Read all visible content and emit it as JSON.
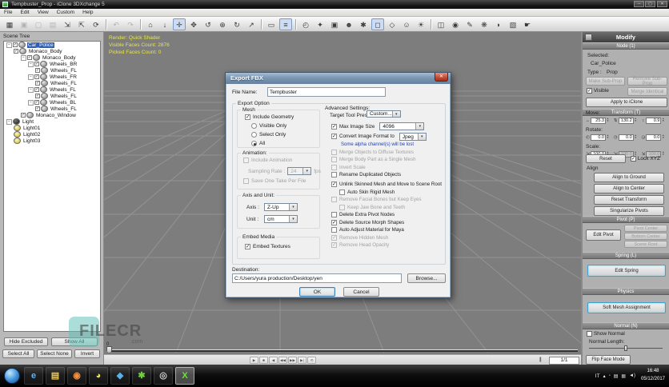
{
  "colors": {
    "selection": "#2f5fb3",
    "hud_text": "#e8e34f",
    "note_blue": "#1a3fc4",
    "watermark_teal": "#66c2b8",
    "accent_button": "#3f9fd0"
  },
  "window": {
    "title": "Tempbuster_Prop - iClone 3DXchange 5",
    "menus": [
      "File",
      "Edit",
      "View",
      "Custom",
      "Help"
    ],
    "controls": {
      "minimize": "─",
      "maximize": "▢",
      "close": "✕"
    }
  },
  "toolbar": {
    "icons": [
      {
        "glyph": "▦",
        "name": "scene-tree-toggle-icon"
      },
      {
        "glyph": "▣",
        "name": "copy-icon",
        "state": "disabled"
      },
      {
        "glyph": "▢",
        "name": "paste-icon",
        "state": "disabled"
      },
      {
        "glyph": "▤",
        "name": "duplicate-icon",
        "state": "disabled"
      },
      {
        "glyph": "⇲",
        "name": "import-icon"
      },
      {
        "glyph": "⇱",
        "name": "export-icon"
      },
      {
        "glyph": "⟳",
        "name": "refresh-icon"
      },
      {
        "sep": true
      },
      {
        "glyph": "↶",
        "name": "undo-icon",
        "state": "disabled"
      },
      {
        "glyph": "↷",
        "name": "redo-icon",
        "state": "disabled"
      },
      {
        "sep": true
      },
      {
        "glyph": "⌂",
        "name": "camera-home-icon"
      },
      {
        "glyph": "↓",
        "name": "camera-top-icon"
      },
      {
        "glyph": "✛",
        "name": "move-tool-icon",
        "state": "pressed"
      },
      {
        "glyph": "✥",
        "name": "pan-tool-icon"
      },
      {
        "glyph": "↺",
        "name": "orbit-tool-icon"
      },
      {
        "glyph": "⊕",
        "name": "zoom-tool-icon"
      },
      {
        "glyph": "↻",
        "name": "rotate-tool-icon"
      },
      {
        "glyph": "↗",
        "name": "frame-all-icon"
      },
      {
        "sep": true
      },
      {
        "glyph": "▭",
        "name": "render-mode-icon"
      },
      {
        "glyph": "≡",
        "name": "scene-list-icon",
        "state": "pressed"
      },
      {
        "sep": true
      },
      {
        "glyph": "◴",
        "name": "turntable-icon"
      },
      {
        "glyph": "✦",
        "name": "pin-icon"
      },
      {
        "glyph": "▣",
        "name": "display-icon"
      },
      {
        "glyph": "☻",
        "name": "avatar-icon"
      },
      {
        "glyph": "✱",
        "name": "settings-icon"
      },
      {
        "glyph": "◻",
        "name": "marquee-select-icon",
        "state": "pressed"
      },
      {
        "glyph": "◇",
        "name": "lock-icon"
      },
      {
        "glyph": "☺",
        "name": "actor-icon"
      },
      {
        "glyph": "☀",
        "name": "light-icon"
      },
      {
        "sep": true
      },
      {
        "glyph": "◫",
        "name": "stage-icon"
      },
      {
        "glyph": "◉",
        "name": "material-icon"
      },
      {
        "glyph": "✎",
        "name": "edit-pose-icon"
      },
      {
        "glyph": "❋",
        "name": "spring-icon"
      },
      {
        "glyph": "◗",
        "name": "head-icon"
      },
      {
        "glyph": "▧",
        "name": "props-icon"
      },
      {
        "glyph": "☛",
        "name": "hand-icon"
      }
    ]
  },
  "scene_tree": {
    "title": "Scene Tree",
    "items": [
      {
        "label": "Car_Police",
        "depth": 0,
        "expander": true,
        "checkbox": true,
        "checked": true,
        "selected": true,
        "icon": "mesh"
      },
      {
        "label": "Monaco_Body",
        "depth": 1,
        "expander": false,
        "checkbox": true,
        "checked": true,
        "icon": "mesh"
      },
      {
        "label": "Monaco_Body",
        "depth": 2,
        "expander": true,
        "checkbox": true,
        "checked": true,
        "icon": "mesh"
      },
      {
        "label": "Wheels_BR",
        "depth": 3,
        "expander": true,
        "checkbox": true,
        "checked": true,
        "icon": "mesh"
      },
      {
        "label": "Wheels_FL",
        "depth": 4,
        "expander": false,
        "checkbox": true,
        "checked": true,
        "icon": "mesh"
      },
      {
        "label": "Wheels_FR",
        "depth": 3,
        "expander": true,
        "checkbox": true,
        "checked": true,
        "icon": "mesh"
      },
      {
        "label": "Wheels_FL",
        "depth": 4,
        "expander": false,
        "checkbox": true,
        "checked": true,
        "icon": "mesh"
      },
      {
        "label": "Wheels_FL",
        "depth": 3,
        "expander": true,
        "checkbox": true,
        "checked": true,
        "icon": "mesh"
      },
      {
        "label": "Wheels_FL",
        "depth": 4,
        "expander": false,
        "checkbox": true,
        "checked": true,
        "icon": "mesh"
      },
      {
        "label": "Wheels_BL",
        "depth": 3,
        "expander": true,
        "checkbox": true,
        "checked": true,
        "icon": "mesh"
      },
      {
        "label": "Wheels_FL",
        "depth": 4,
        "expander": false,
        "checkbox": true,
        "checked": true,
        "icon": "mesh"
      },
      {
        "label": "Monaco_Window",
        "depth": 2,
        "expander": false,
        "checkbox": true,
        "checked": true,
        "icon": "mesh"
      },
      {
        "label": "Light",
        "depth": 0,
        "expander": true,
        "checkbox": false,
        "icon": "dark"
      },
      {
        "label": "Light01",
        "depth": 1,
        "expander": false,
        "checkbox": false,
        "icon": "bulb"
      },
      {
        "label": "Light02",
        "depth": 1,
        "expander": false,
        "checkbox": false,
        "icon": "bulb"
      },
      {
        "label": "Light03",
        "depth": 1,
        "expander": false,
        "checkbox": false,
        "icon": "bulb"
      }
    ],
    "buttons_row1": [
      "Hide Excluded",
      "Show All"
    ],
    "buttons_row2": [
      "Select All",
      "Select None",
      "Invert"
    ]
  },
  "viewport": {
    "hud": {
      "line1": "Render: Quick Shader",
      "line2": "Visible Faces Count: 2876",
      "line3": "Picked Faces Count: 0"
    },
    "watermark": {
      "brand": "FILECR",
      "suffix": ".com"
    },
    "timeline": {
      "start_label": "0",
      "frame_counter": "1/1",
      "counter_icon": "|||",
      "transport": [
        {
          "glyph": "▶",
          "name": "play-button"
        },
        {
          "glyph": "■",
          "name": "stop-button"
        },
        {
          "glyph": "◀",
          "name": "prev-frame-button"
        },
        {
          "glyph": "◀◀",
          "name": "first-frame-button"
        },
        {
          "glyph": "▶▶",
          "name": "fast-forward-button"
        },
        {
          "glyph": "▶|",
          "name": "last-frame-button"
        },
        {
          "glyph": "⟲",
          "name": "loop-button"
        }
      ]
    }
  },
  "dialog": {
    "title": "Export FBX",
    "close_glyph": "✕",
    "file_name_label": "File Name:",
    "file_name_value": "Tempbuster",
    "group_title": "Export Option",
    "mesh": {
      "title": "Mesh",
      "include_geometry": "Include Geometry",
      "radios": [
        {
          "label": "Visible Only",
          "selected": false
        },
        {
          "label": "Select Only",
          "selected": false
        },
        {
          "label": "All",
          "selected": true
        }
      ]
    },
    "animation": {
      "title": "Animation:",
      "include": "Include Animation",
      "sampling_label": "Sampling Rate :",
      "sampling_value": "24",
      "sampling_unit": "fps",
      "save_take": "Save One Take Per File"
    },
    "axis_unit": {
      "title": "Axis and Unit:",
      "axis_label": "Axis :",
      "axis_value": "Z-Up",
      "unit_label": "Unit :",
      "unit_value": "cm"
    },
    "embed": {
      "title": "Embed Media",
      "label": "Embed Textures"
    },
    "advanced": {
      "title": "Advanced Settings:",
      "preset_label": "Target Tool Preset:",
      "preset_value": "Custom...",
      "items": [
        {
          "label": "Max Image Size",
          "checked": true,
          "combo": "4096"
        },
        {
          "label": "Convert Image Format to",
          "checked": true,
          "combo": "Jpeg",
          "note": "Some alpha channel(s) will be lost"
        },
        {
          "label": "Merge Objects to Diffuse Textures",
          "disabled": true
        },
        {
          "label": "Merge Body Part as a Single Mesh",
          "disabled": true
        },
        {
          "label": "Invert Scale",
          "disabled": true
        },
        {
          "label": "Rename Duplicated Objects"
        },
        {
          "label": "Unlink Skinned Mesh and Move to Scene Root",
          "checked": true,
          "gap_before": true
        },
        {
          "label": "Auto Skin Rigid Mesh",
          "indent": 1
        },
        {
          "label": "Remove Facial Bones but Keep Eyes",
          "disabled": true
        },
        {
          "label": "Keep Jaw Bone and Teeth",
          "disabled": true,
          "indent": 1
        },
        {
          "label": "Delete Extra Pivot Nodes"
        },
        {
          "label": "Delete Source Morph Shapes",
          "checked": true
        },
        {
          "label": "Auto Adjust Material for Maya"
        },
        {
          "label": "Remove Hidden Mesh",
          "checked": true,
          "disabled": true
        },
        {
          "label": "Remove Head Opacity",
          "checked": true,
          "disabled": true
        }
      ]
    },
    "destination_label": "Destination:",
    "destination_value": "C:/Users/yura production/Desktop/yen",
    "browse_label": "Browse...",
    "ok_label": "OK",
    "cancel_label": "Cancel"
  },
  "modify": {
    "title": "Modify",
    "node_section": "Node (1)",
    "selected_label": "Selected:",
    "selected_value": "Car_Police",
    "type_label": "Type :",
    "type_value": "Prop",
    "make_sub": "Make Sub-Prop",
    "remove_sub": "Remove Sub-Prop",
    "visible_label": "Visible",
    "merge_identical": "Merge Identical",
    "apply": "Apply to iClone",
    "transform_section": "Transform (T)",
    "rows": [
      {
        "label": "Move:",
        "icons": [
          "↔",
          "⇅",
          "↕"
        ],
        "values": [
          "25.3",
          "130.2",
          "0.9"
        ],
        "disabled": [
          false,
          false,
          false
        ]
      },
      {
        "label": "Rotate:",
        "icons": [
          "◴",
          "◷",
          "◶"
        ],
        "values": [
          "0.0",
          "0.0",
          "0.0"
        ],
        "disabled": [
          false,
          false,
          false
        ]
      },
      {
        "label": "Scale:",
        "icons": [
          "⇲",
          "⇲",
          "⇲"
        ],
        "values": [
          "100.0",
          "100.0",
          "100.0"
        ],
        "disabled": [
          false,
          true,
          true
        ]
      }
    ],
    "reset": "Reset",
    "lock": "Lock XYZ",
    "align_label": "Align",
    "align_buttons": [
      "Align to Ground",
      "Align to Center",
      "Reset Transform",
      "Singularize Pivots"
    ],
    "pivot_section": "Pivot (P)",
    "edit_pivot": "Edit Pivot",
    "pivot_buttons": [
      "Pivot Center",
      "Bottom Center",
      "Scene Root"
    ],
    "spring_section": "Spring (L)",
    "edit_spring": "Edit Spring",
    "physics_section": "Physics",
    "soft_mesh": "Soft Mesh Assignment",
    "normal_section": "Normal (N)",
    "show_normal": "Show Normal",
    "normal_length": "Normal Length:",
    "flip_face": "Flip Face Mode"
  },
  "taskbar": {
    "apps": [
      {
        "glyph": "e",
        "name": "taskbar-ie-icon",
        "color": "#5fb4f0"
      },
      {
        "glyph": "▤",
        "name": "taskbar-explorer-icon",
        "color": "#e8c860"
      },
      {
        "glyph": "◉",
        "name": "taskbar-media-player-icon",
        "color": "#f09040"
      },
      {
        "glyph": "◕",
        "name": "taskbar-chrome-icon",
        "color": "#f0e060"
      },
      {
        "glyph": "◆",
        "name": "taskbar-3ds-icon",
        "color": "#58b0e8"
      },
      {
        "glyph": "✱",
        "name": "taskbar-utility-icon",
        "color": "#70d040"
      },
      {
        "glyph": "◎",
        "name": "taskbar-recorder-icon",
        "color": "#cfcfcf"
      },
      {
        "glyph": "X",
        "name": "taskbar-3dxchange-icon",
        "color": "#6fe040",
        "active": true
      }
    ],
    "tray": {
      "lang": "IT",
      "icons": [
        {
          "glyph": "▴",
          "name": "tray-expand-icon"
        },
        {
          "glyph": "▪",
          "name": "tray-app1-icon",
          "color": "#e05040"
        },
        {
          "glyph": "▤",
          "name": "tray-app2-icon",
          "color": "#e8e8e8"
        },
        {
          "glyph": "▦",
          "name": "tray-app3-icon",
          "color": "#c0c0c0"
        },
        {
          "glyph": "◄)",
          "name": "tray-volume-icon",
          "color": "#e8e8e8"
        }
      ],
      "time": "16:48",
      "date": "05/12/2017"
    }
  }
}
